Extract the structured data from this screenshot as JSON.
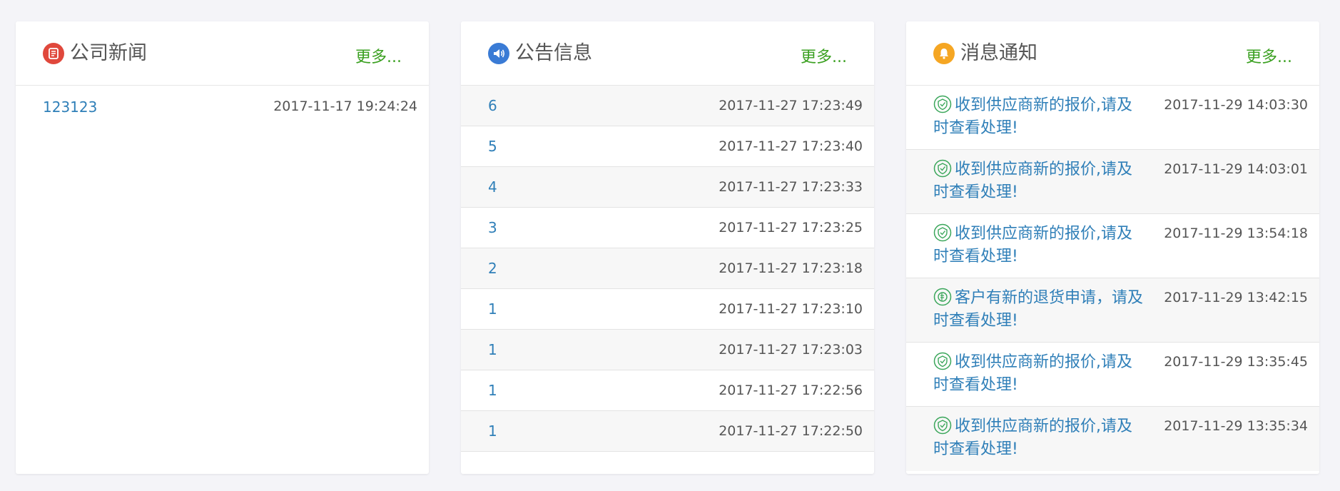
{
  "colors": {
    "news_icon": "#e0483c",
    "announce_icon": "#3a7bd5",
    "message_icon": "#f5a623",
    "link": "#2f7fb8",
    "more": "#3aa020",
    "msg_icon_green": "#3aa65a"
  },
  "news": {
    "title": "公司新闻",
    "icon": "document-icon",
    "more_label": "更多...",
    "items": [
      {
        "title": "123123",
        "time": "2017-11-17 19:24:24"
      }
    ]
  },
  "announcements": {
    "title": "公告信息",
    "icon": "speaker-icon",
    "more_label": "更多...",
    "items": [
      {
        "title": "6",
        "time": "2017-11-27 17:23:49"
      },
      {
        "title": "5",
        "time": "2017-11-27 17:23:40"
      },
      {
        "title": "4",
        "time": "2017-11-27 17:23:33"
      },
      {
        "title": "3",
        "time": "2017-11-27 17:23:25"
      },
      {
        "title": "2",
        "time": "2017-11-27 17:23:18"
      },
      {
        "title": "1",
        "time": "2017-11-27 17:23:10"
      },
      {
        "title": "1",
        "time": "2017-11-27 17:23:03"
      },
      {
        "title": "1",
        "time": "2017-11-27 17:22:56"
      },
      {
        "title": "1",
        "time": "2017-11-27 17:22:50"
      }
    ]
  },
  "messages": {
    "title": "消息通知",
    "icon": "bell-icon",
    "more_label": "更多...",
    "items": [
      {
        "icon": "quote-icon",
        "text": "收到供应商新的报价,请及时查看处理!",
        "time": "2017-11-29 14:03:30"
      },
      {
        "icon": "quote-icon",
        "text": "收到供应商新的报价,请及时查看处理!",
        "time": "2017-11-29 14:03:01"
      },
      {
        "icon": "quote-icon",
        "text": "收到供应商新的报价,请及时查看处理!",
        "time": "2017-11-29 13:54:18"
      },
      {
        "icon": "return-icon",
        "text": "客户有新的退货申请，请及时查看处理!",
        "time": "2017-11-29 13:42:15"
      },
      {
        "icon": "quote-icon",
        "text": "收到供应商新的报价,请及时查看处理!",
        "time": "2017-11-29 13:35:45"
      },
      {
        "icon": "quote-icon",
        "text": "收到供应商新的报价,请及时查看处理!",
        "time": "2017-11-29 13:35:34"
      }
    ]
  }
}
